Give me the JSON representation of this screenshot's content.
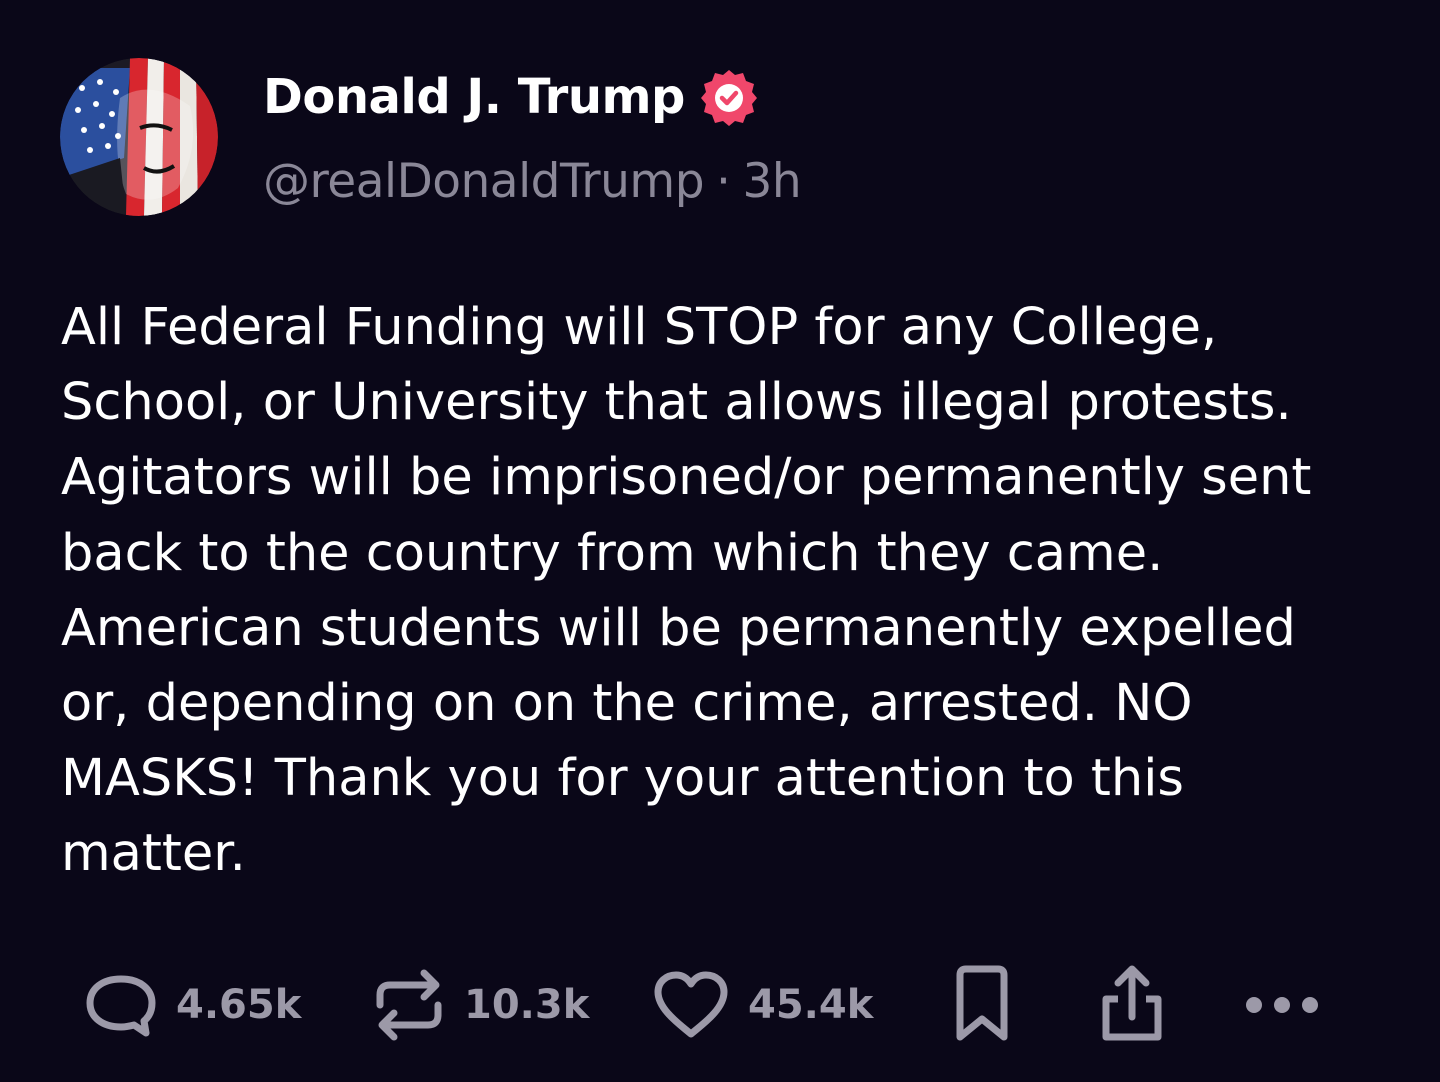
{
  "author": {
    "display_name": "Donald J. Trump",
    "handle": "@realDonaldTrump",
    "separator": "·",
    "time": "3h",
    "verified_icon": "verified-badge-icon",
    "avatar_icon": "american-flag-face-avatar"
  },
  "post": {
    "lines": [
      "All Federal Funding will STOP for any College,",
      "School, or University that allows illegal protests.",
      "Agitators will be imprisoned/or permanently sent",
      "back to the country from which they came.",
      "American students will be permanently expelled",
      "or, depending on on the crime, arrested. NO",
      "MASKS! Thank you for your attention to this",
      "matter."
    ]
  },
  "actions": {
    "replies": {
      "icon": "reply-icon",
      "count": "4.65k"
    },
    "reposts": {
      "icon": "repost-icon",
      "count": "10.3k"
    },
    "likes": {
      "icon": "heart-icon",
      "count": "45.4k"
    },
    "bookmark": {
      "icon": "bookmark-icon"
    },
    "share": {
      "icon": "share-icon"
    },
    "more": {
      "icon": "more-icon"
    }
  },
  "colors": {
    "background": "#0a0718",
    "text_primary": "#ffffff",
    "text_secondary": "#8a8797",
    "action_gray": "#9c99a8",
    "verified_pink": "#f0476b"
  }
}
